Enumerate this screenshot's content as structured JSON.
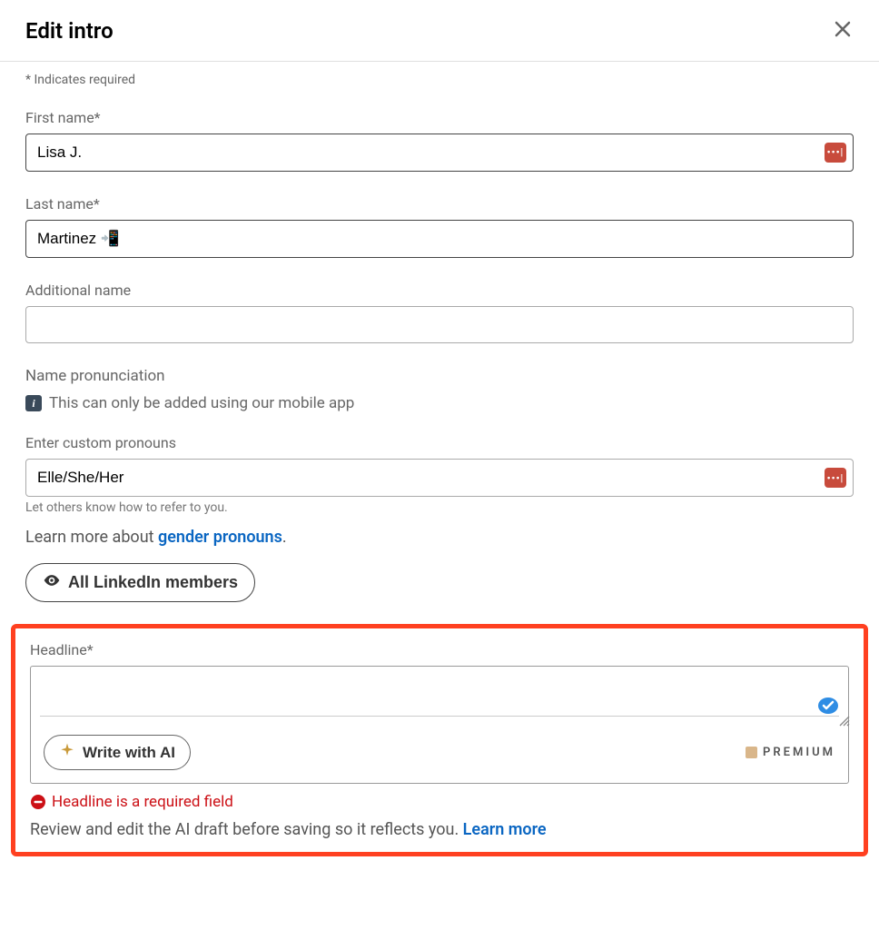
{
  "header": {
    "title": "Edit intro"
  },
  "requiredNote": "* Indicates required",
  "fields": {
    "firstName": {
      "label": "First name*",
      "value": "Lisa J."
    },
    "lastName": {
      "label": "Last name*",
      "value": "Martinez 📲"
    },
    "additionalName": {
      "label": "Additional name",
      "value": ""
    },
    "pronunciation": {
      "label": "Name pronunciation",
      "infoText": "This can only be added using our mobile app"
    },
    "pronouns": {
      "label": "Enter custom pronouns",
      "value": "Elle/She/Her",
      "hint": "Let others know how to refer to you.",
      "learnPrefix": "Learn more about ",
      "learnLink": "gender pronouns",
      "learnSuffix": "."
    },
    "visibility": {
      "buttonLabel": "All LinkedIn members"
    },
    "headline": {
      "label": "Headline*",
      "value": "",
      "aiButton": "Write with AI",
      "premiumLabel": "PREMIUM",
      "errorText": "Headline is a required field",
      "reviewText": "Review and edit the AI draft before saving so it reflects you. ",
      "reviewLink": "Learn more"
    }
  }
}
